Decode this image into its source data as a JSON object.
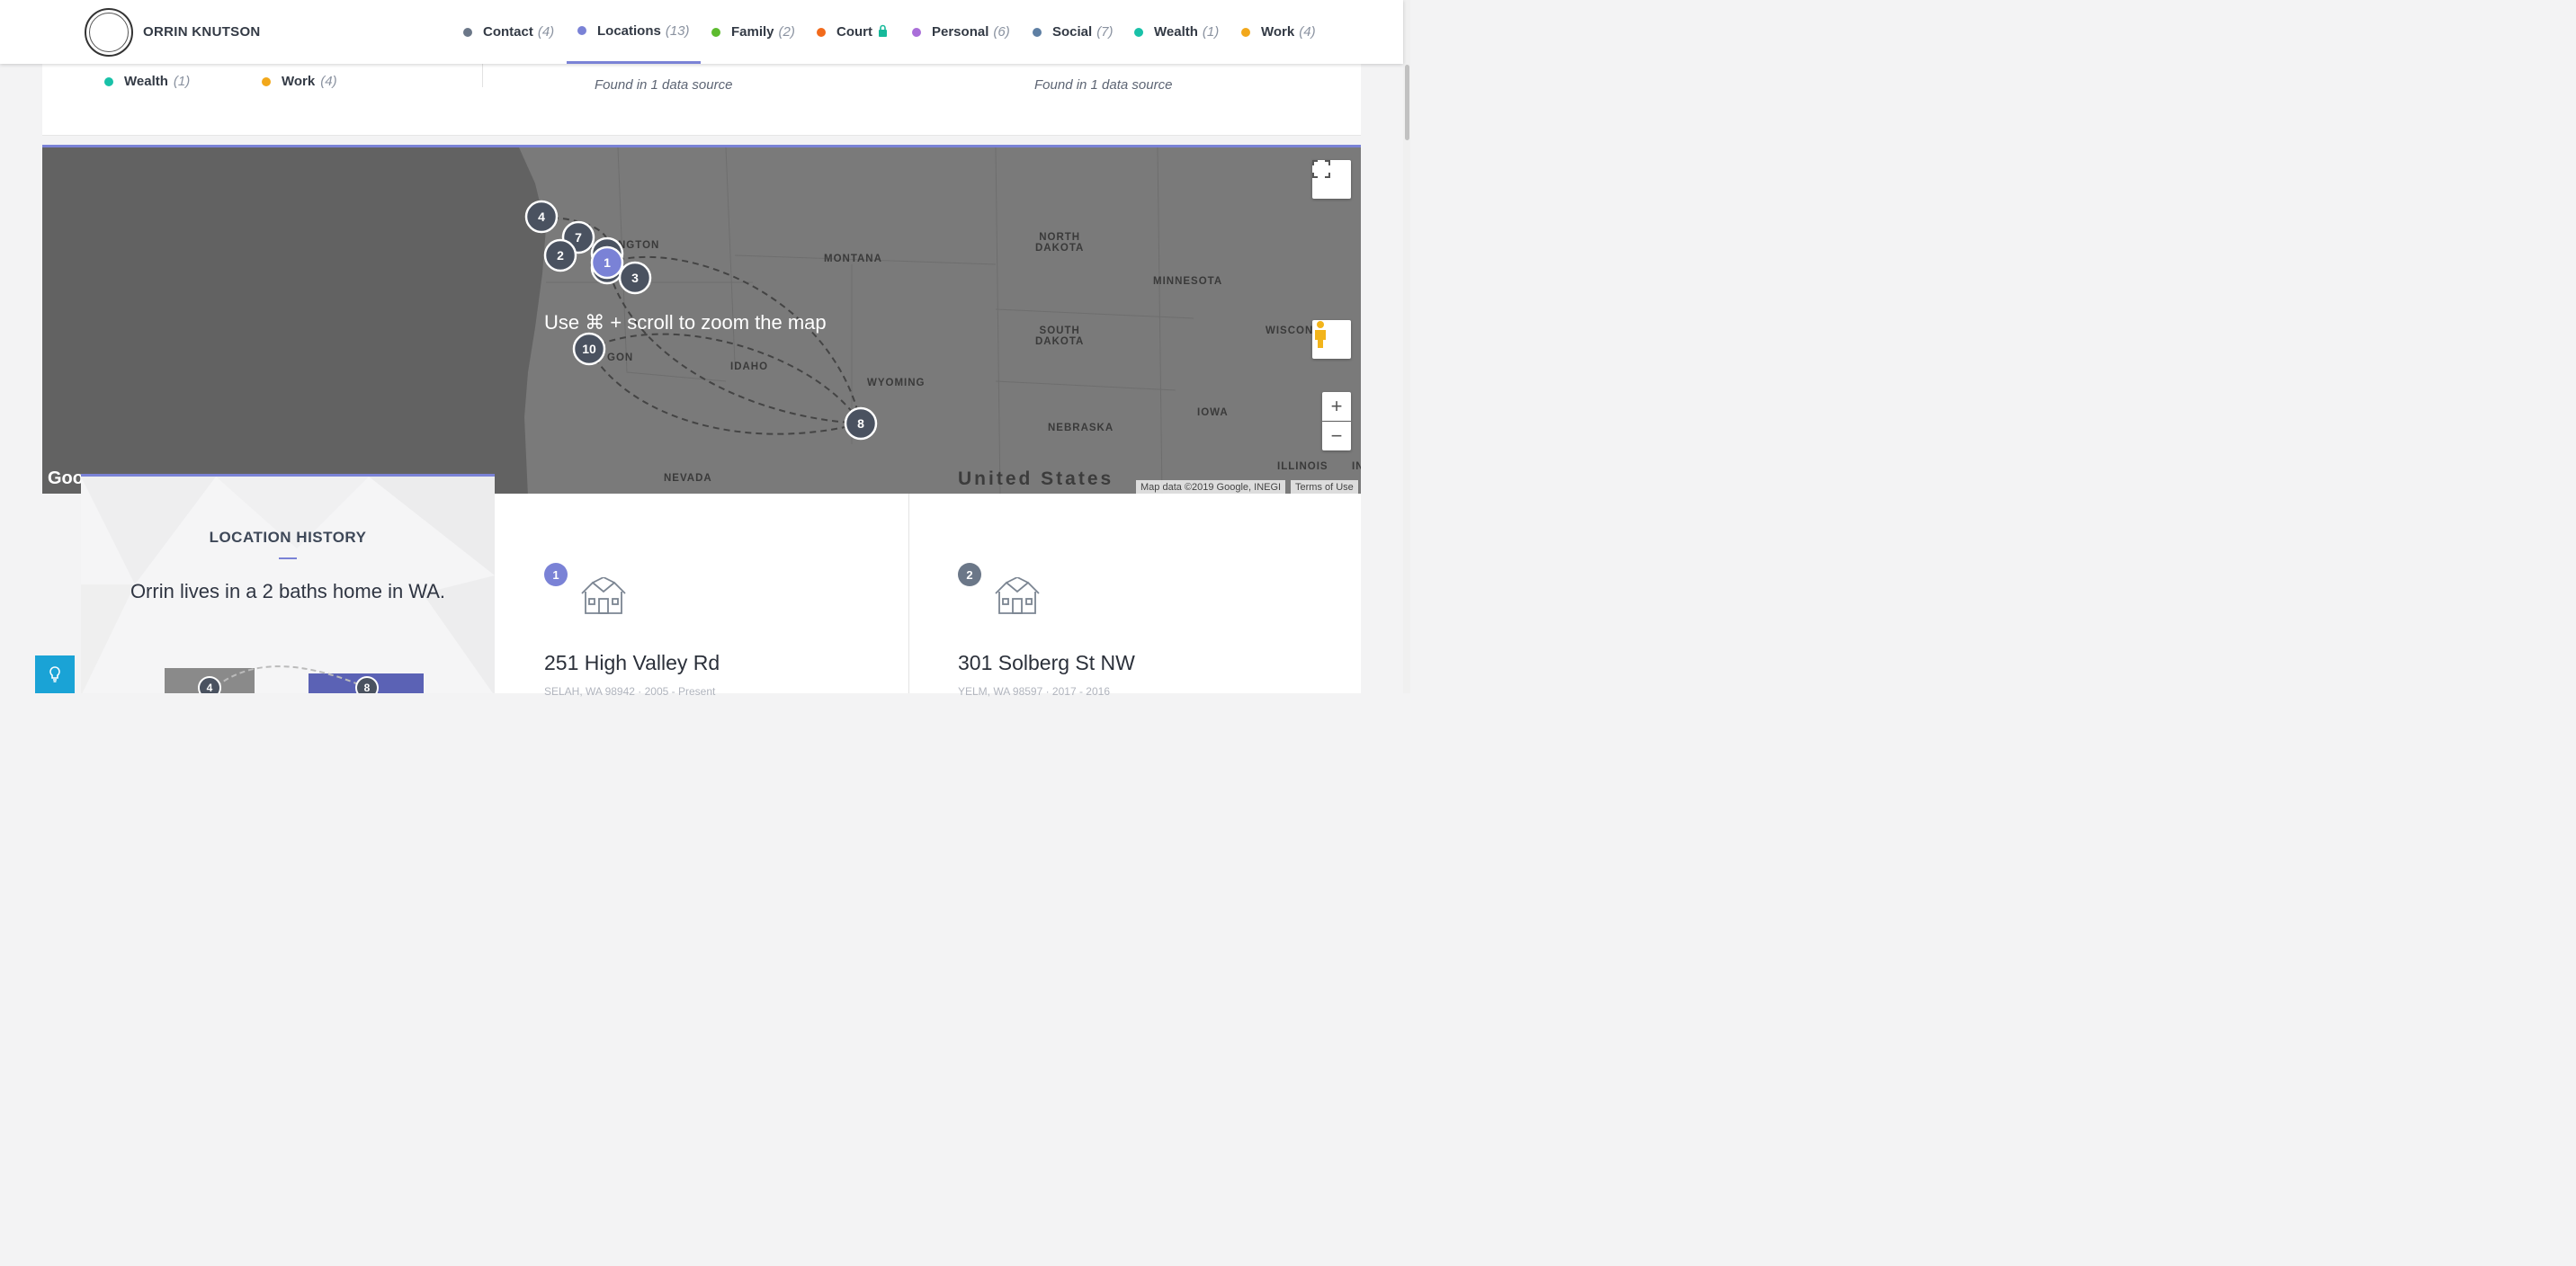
{
  "header": {
    "name": "ORRIN KNUTSON",
    "nav": [
      {
        "label": "Contact",
        "count": "(4)",
        "color": "#6b7788"
      },
      {
        "label": "Locations",
        "count": "(13)",
        "color": "#7a82d6",
        "active": true
      },
      {
        "label": "Family",
        "count": "(2)",
        "color": "#5dbb2e"
      },
      {
        "label": "Court",
        "count": "",
        "color": "#f26a1b",
        "locked": true
      },
      {
        "label": "Personal",
        "count": "(6)",
        "color": "#a96ed9"
      },
      {
        "label": "Social",
        "count": "(7)",
        "color": "#5e7fa3"
      },
      {
        "label": "Wealth",
        "count": "(1)",
        "color": "#19c1a8"
      },
      {
        "label": "Work",
        "count": "(4)",
        "color": "#f2a81b"
      }
    ]
  },
  "summary": {
    "mini": [
      {
        "label": "Wealth",
        "count": "(1)",
        "color": "#19c1a8"
      },
      {
        "label": "Work",
        "count": "(4)",
        "color": "#f2a81b"
      }
    ],
    "found_1": "Found in 1 data source",
    "found_2": "Found in 1 data source"
  },
  "map": {
    "zoom_hint": "Use ⌘ + scroll to zoom the map",
    "country_label": "United States",
    "google_label": "Goo",
    "attribution": "Map data ©2019 Google, INEGI",
    "terms": "Terms of Use",
    "zoom_in": "+",
    "zoom_out": "−",
    "states": [
      {
        "name": "NGTON"
      },
      {
        "name": "MONTANA"
      },
      {
        "name": "NORTH\nDAKOTA"
      },
      {
        "name": "MINNESOTA"
      },
      {
        "name": "SOUTH\nDAKOTA"
      },
      {
        "name": "WISCON"
      },
      {
        "name": "GON"
      },
      {
        "name": "IDAHO"
      },
      {
        "name": "WYOMING"
      },
      {
        "name": "IOWA"
      },
      {
        "name": "NEBRASKA"
      },
      {
        "name": "NEVADA"
      },
      {
        "name": "ILLINOIS"
      },
      {
        "name": "IN"
      }
    ],
    "markers": [
      {
        "label": "4"
      },
      {
        "label": "7"
      },
      {
        "label": "2"
      },
      {
        "label": "1",
        "active": true
      },
      {
        "label": "3"
      },
      {
        "label": "10"
      },
      {
        "label": "8"
      }
    ]
  },
  "history": {
    "title": "LOCATION HISTORY",
    "description": "Orrin lives in a 2 baths home in WA.",
    "mini_markers": [
      "4",
      "8"
    ]
  },
  "locations": [
    {
      "number": "1",
      "address": "251 High Valley Rd",
      "subtitle": "SELAH, WA 98942 · 2005 - Present",
      "badge_color": "#7a82d6"
    },
    {
      "number": "2",
      "address": "301 Solberg St NW",
      "subtitle": "YELM, WA 98597 · 2017 - 2016",
      "badge_color": "#6b7788"
    }
  ]
}
